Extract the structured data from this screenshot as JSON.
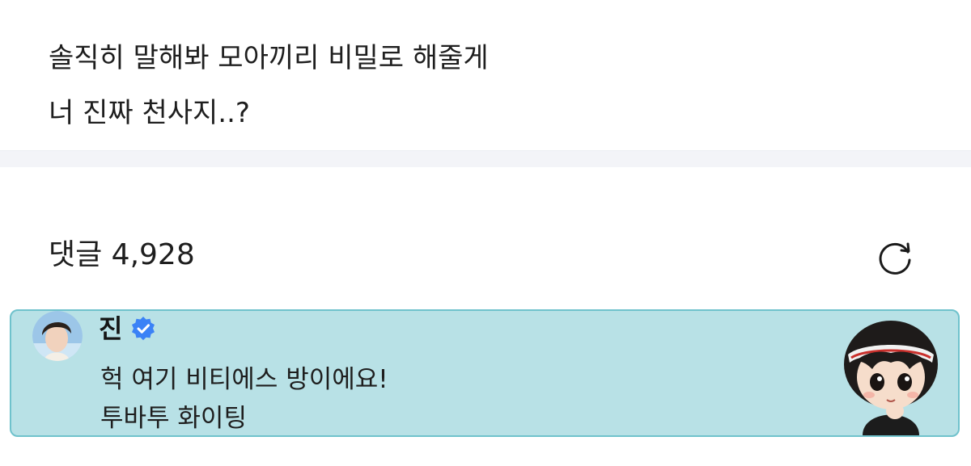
{
  "post": {
    "lines": [
      "솔직히 말해봐 모아끼리 비밀로 해줄게",
      "너 진짜 천사지..?"
    ]
  },
  "comments": {
    "title": "댓글 4,928",
    "refresh_icon": "refresh-icon"
  },
  "highlighted_comment": {
    "author": "진",
    "verified_icon": "verified-badge-icon",
    "lines": [
      "헉 여기 비티에스 방이에요!",
      "투바투 화이팅"
    ],
    "sticker": "chibi-character-sticker",
    "colors": {
      "background": "#b8e1e6",
      "border": "#6fc2cc",
      "verified": "#3b82f6"
    }
  }
}
